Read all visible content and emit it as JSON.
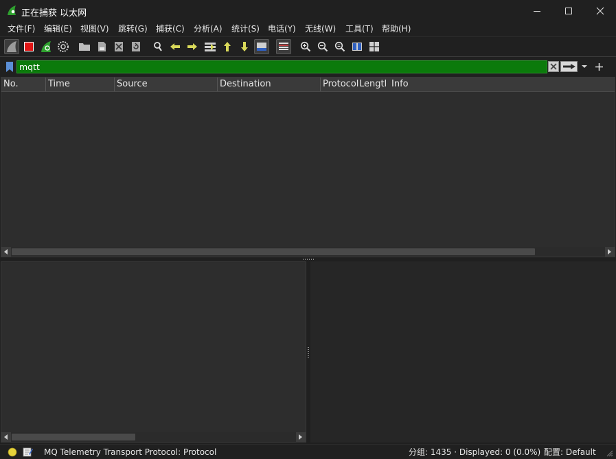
{
  "window": {
    "title": "正在捕获 以太网",
    "controls": [
      "minimize-icon",
      "maximize-icon",
      "close-icon"
    ]
  },
  "menu": [
    "文件(F)",
    "编辑(E)",
    "视图(V)",
    "跳转(G)",
    "捕获(C)",
    "分析(A)",
    "统计(S)",
    "电话(Y)",
    "无线(W)",
    "工具(T)",
    "帮助(H)"
  ],
  "toolbar": {
    "icons": [
      "start-capture-icon",
      "stop-capture-icon",
      "restart-capture-icon",
      "capture-options-icon",
      "open-file-icon",
      "save-file-icon",
      "close-file-icon",
      "reload-file-icon",
      "find-packet-icon",
      "go-back-icon",
      "go-forward-icon",
      "go-to-packet-icon",
      "first-packet-icon",
      "last-packet-icon",
      "autoscroll-icon",
      "colorize-icon",
      "zoom-in-icon",
      "zoom-out-icon",
      "normal-size-icon",
      "resize-columns-icon"
    ]
  },
  "filter": {
    "value": "mqtt",
    "valid_color": "#0b7a0b"
  },
  "packet_list": {
    "columns": [
      "No.",
      "Time",
      "Source",
      "Destination",
      "Protocol",
      "Lengtl",
      "Info"
    ],
    "rows": []
  },
  "status": {
    "expert_indicator_color": "#e6d23a",
    "field_description": "MQ Telemetry Transport Protocol: Protocol",
    "packets": "分组: 1435 · Displayed: 0 (0.0%)",
    "profile": "配置: Default"
  }
}
